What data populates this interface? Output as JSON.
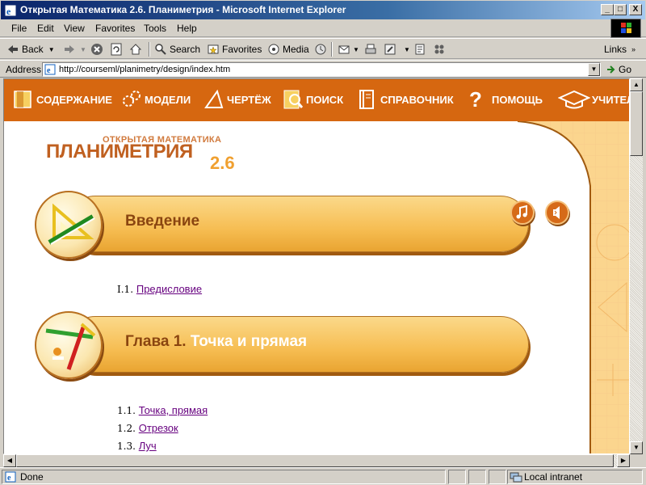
{
  "window": {
    "title": "Открытая Математика 2.6. Планиметрия - Microsoft Internet Explorer",
    "minimize": "_",
    "maximize": "□",
    "close": "X"
  },
  "menu": [
    "File",
    "Edit",
    "View",
    "Favorites",
    "Tools",
    "Help"
  ],
  "toolbar": {
    "back": "Back",
    "search": "Search",
    "favorites": "Favorites",
    "media": "Media",
    "links": "Links"
  },
  "address": {
    "label": "Address",
    "url": "http://courseml/planimetry/design/index.htm",
    "go": "Go"
  },
  "nav": {
    "contents": "СОДЕРЖАНИЕ",
    "models": "МОДЕЛИ",
    "drawing": "ЧЕРТЁЖ",
    "search": "ПОИСК",
    "reference": "СПРАВОЧНИК",
    "help": "ПОМОЩЬ",
    "teacher": "УЧИТЕЛЮ"
  },
  "logo": {
    "subtitle": "ОТКРЫТАЯ МАТЕМАТИКА",
    "title": "ПЛАНИМЕТРИЯ",
    "version": "2.6"
  },
  "chapters": [
    {
      "title": "Введение",
      "title_rest": "",
      "sections": [
        {
          "num": "I.1.",
          "label": "Предисловие"
        }
      ]
    },
    {
      "title": "Глава 1.",
      "title_rest": " Точка и прямая",
      "sections": [
        {
          "num": "1.1.",
          "label": "Точка, прямая"
        },
        {
          "num": "1.2.",
          "label": "Отрезок"
        },
        {
          "num": "1.3.",
          "label": "Луч"
        }
      ]
    }
  ],
  "status": {
    "text": "Done",
    "zone": "Local intranet"
  },
  "colors": {
    "nav_bg": "#d66710",
    "pill": "#f6bd52",
    "link_visited": "#66007f"
  }
}
